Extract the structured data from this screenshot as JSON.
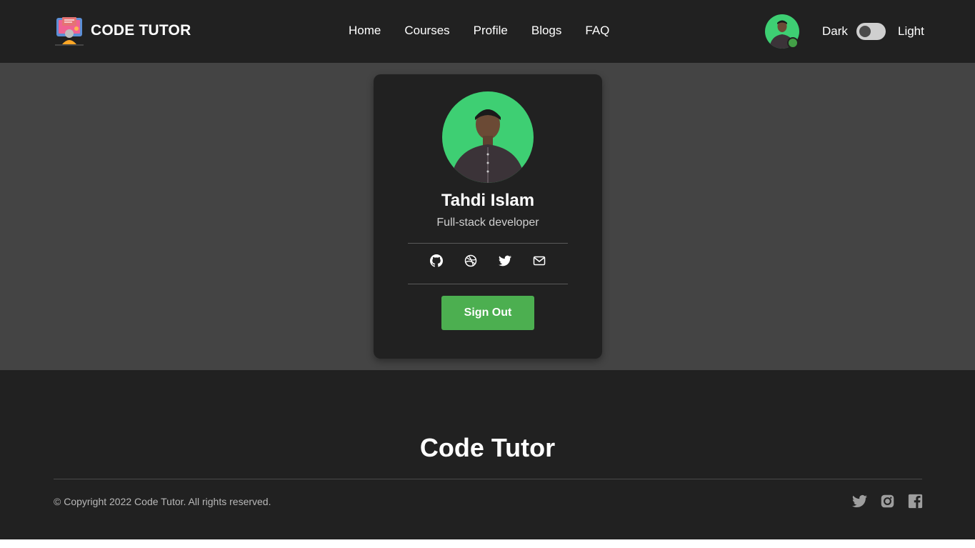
{
  "brand": {
    "name": "CODE TUTOR",
    "logo_icon": "computer-tutor-logo-icon"
  },
  "nav": {
    "items": [
      {
        "label": "Home"
      },
      {
        "label": "Courses"
      },
      {
        "label": "Profile"
      },
      {
        "label": "Blogs"
      },
      {
        "label": "FAQ"
      }
    ],
    "theme": {
      "dark_label": "Dark",
      "light_label": "Light",
      "mode": "dark"
    },
    "avatar_status": "online"
  },
  "profile": {
    "name": "Tahdi Islam",
    "role": "Full-stack developer",
    "social_icons": [
      "github-icon",
      "dribbble-icon",
      "twitter-icon",
      "mail-icon"
    ],
    "signout_label": "Sign Out"
  },
  "footer": {
    "title": "Code Tutor",
    "copyright": "© Copyright 2022 Code Tutor. All rights reserved.",
    "social_icons": [
      "twitter-icon",
      "instagram-icon",
      "facebook-icon"
    ]
  },
  "colors": {
    "nav_bg": "#212121",
    "page_bg": "#444444",
    "accent_green": "#4caf50",
    "text": "#ffffff"
  }
}
